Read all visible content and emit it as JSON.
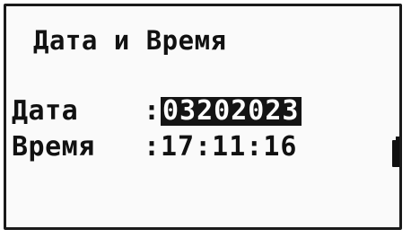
{
  "screen": {
    "title": "Дата и Время",
    "date": {
      "label": "Дата",
      "separator": ":",
      "value": "03202023"
    },
    "time": {
      "label": "Время",
      "separator": ":",
      "value": "17:11:16"
    },
    "battery_icon": "battery-full-icon"
  },
  "colors": {
    "background": "#fafafa",
    "text": "#111111",
    "highlight": "#141414"
  }
}
